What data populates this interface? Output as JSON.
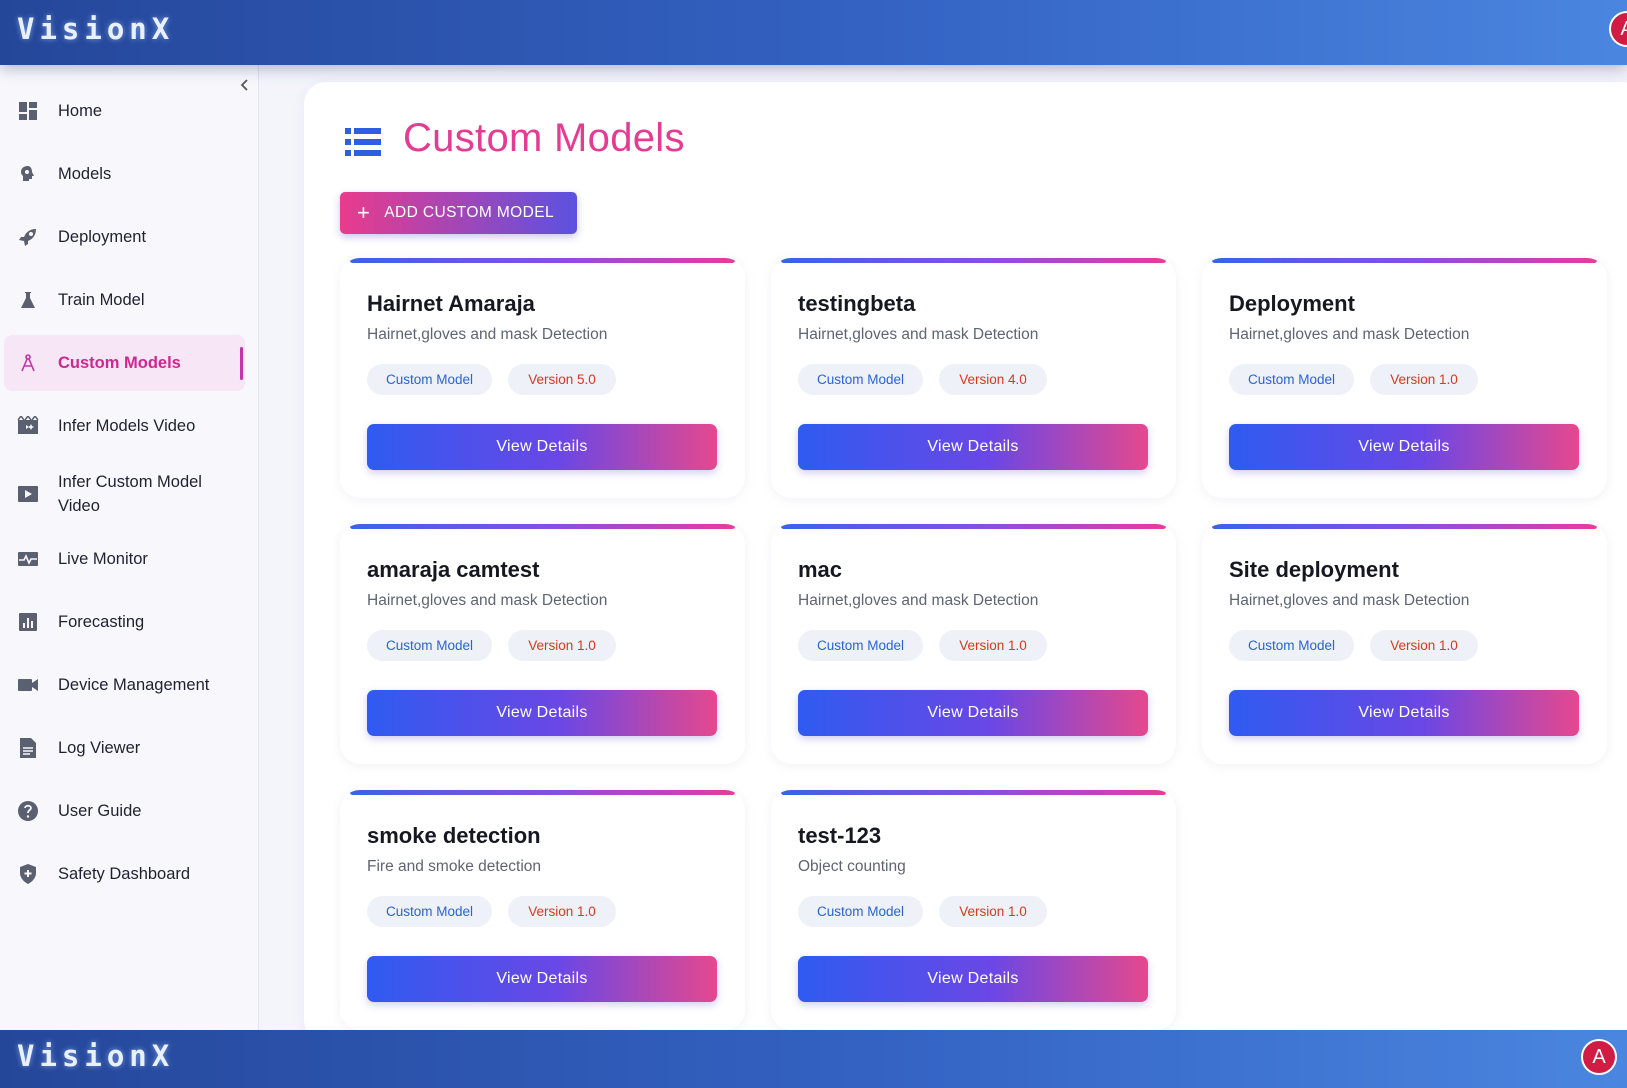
{
  "app": {
    "brand": "VisionX",
    "avatar_initial": "A"
  },
  "sidebar": {
    "collapse_icon": "chevron-left-icon",
    "items": [
      {
        "label": "Home",
        "icon": "dashboard-icon"
      },
      {
        "label": "Models",
        "icon": "brain-icon"
      },
      {
        "label": "Deployment",
        "icon": "rocket-icon"
      },
      {
        "label": "Train Model",
        "icon": "flask-icon"
      },
      {
        "label": "Custom Models",
        "icon": "compass-icon",
        "active": true
      },
      {
        "label": "Infer Models Video",
        "icon": "video-edit-icon"
      },
      {
        "label": "Infer Custom Model Video",
        "icon": "play-icon"
      },
      {
        "label": "Live Monitor",
        "icon": "monitor-heart-icon"
      },
      {
        "label": "Forecasting",
        "icon": "bar-chart-icon"
      },
      {
        "label": "Device Management",
        "icon": "camera-icon"
      },
      {
        "label": "Log Viewer",
        "icon": "document-icon"
      },
      {
        "label": "User Guide",
        "icon": "help-icon"
      },
      {
        "label": "Safety Dashboard",
        "icon": "shield-icon"
      }
    ]
  },
  "page": {
    "title": "Custom Models",
    "title_icon": "list-icon",
    "add_button_label": "ADD CUSTOM MODEL"
  },
  "cards": [
    {
      "title": "Hairnet Amaraja",
      "description": "Hairnet,gloves and mask Detection",
      "type": "Custom Model",
      "version": "Version 5.0",
      "button": "View Details"
    },
    {
      "title": "testingbeta",
      "description": "Hairnet,gloves and mask Detection",
      "type": "Custom Model",
      "version": "Version 4.0",
      "button": "View Details"
    },
    {
      "title": "Deployment",
      "description": "Hairnet,gloves and mask Detection",
      "type": "Custom Model",
      "version": "Version 1.0",
      "button": "View Details"
    },
    {
      "title": "amaraja camtest",
      "description": "Hairnet,gloves and mask Detection",
      "type": "Custom Model",
      "version": "Version 1.0",
      "button": "View Details"
    },
    {
      "title": "mac",
      "description": "Hairnet,gloves and mask Detection",
      "type": "Custom Model",
      "version": "Version 1.0",
      "button": "View Details"
    },
    {
      "title": "Site deployment",
      "description": "Hairnet,gloves and mask Detection",
      "type": "Custom Model",
      "version": "Version 1.0",
      "button": "View Details"
    },
    {
      "title": "smoke detection",
      "description": "Fire and smoke detection",
      "type": "Custom Model",
      "version": "Version 1.0",
      "button": "View Details"
    },
    {
      "title": "test-123",
      "description": "Object counting",
      "type": "Custom Model",
      "version": "Version 1.0",
      "button": "View Details"
    }
  ],
  "colors": {
    "accent_pink": "#e43c92",
    "accent_blue": "#2f5bf0",
    "header_blue": "#3463c4"
  }
}
